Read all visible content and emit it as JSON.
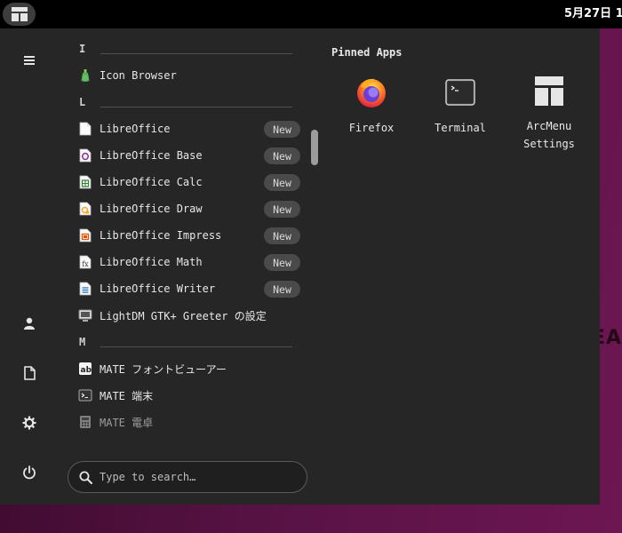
{
  "topbar": {
    "clock": "5月27日 1"
  },
  "watermark": {
    "text": "CDEA"
  },
  "sidebar": {
    "items": [
      {
        "name": "hamburger-menu"
      },
      {
        "name": "user"
      },
      {
        "name": "documents"
      },
      {
        "name": "settings"
      },
      {
        "name": "power"
      }
    ]
  },
  "app_list": {
    "sections": [
      {
        "letter": "I"
      },
      {
        "letter": "L"
      },
      {
        "letter": "M"
      }
    ],
    "apps": [
      {
        "label": "Icon Browser",
        "icon": "icon-browser-icon",
        "badge": ""
      },
      {
        "label": "LibreOffice",
        "icon": "libreoffice-icon",
        "badge": "New"
      },
      {
        "label": "LibreOffice Base",
        "icon": "libreoffice-base-icon",
        "badge": "New"
      },
      {
        "label": "LibreOffice Calc",
        "icon": "libreoffice-calc-icon",
        "badge": "New"
      },
      {
        "label": "LibreOffice Draw",
        "icon": "libreoffice-draw-icon",
        "badge": "New"
      },
      {
        "label": "LibreOffice Impress",
        "icon": "libreoffice-impress-icon",
        "badge": "New"
      },
      {
        "label": "LibreOffice Math",
        "icon": "libreoffice-math-icon",
        "badge": "New"
      },
      {
        "label": "LibreOffice Writer",
        "icon": "libreoffice-writer-icon",
        "badge": "New"
      },
      {
        "label": "LightDM GTK+ Greeter の設定",
        "icon": "lightdm-greeter-icon",
        "badge": ""
      },
      {
        "label": "MATE フォントビューアー",
        "icon": "font-viewer-icon",
        "badge": ""
      },
      {
        "label": "MATE 端末",
        "icon": "terminal-icon",
        "badge": ""
      },
      {
        "label": "MATE 電卓",
        "icon": "calculator-icon",
        "badge": ""
      }
    ]
  },
  "search": {
    "placeholder": "Type to search…"
  },
  "pinned": {
    "title": "Pinned Apps",
    "apps": [
      {
        "label": "Firefox",
        "icon": "firefox-icon"
      },
      {
        "label": "Terminal",
        "icon": "terminal-icon"
      },
      {
        "label_line1": "ArcMenu",
        "label_line2": "Settings",
        "icon": "arcmenu-layout-icon"
      }
    ]
  },
  "colors": {
    "menu_bg": "#262626",
    "badge_bg": "#4a4a4a",
    "topbar_bg": "#000000",
    "desktop_accent": "#6d1652"
  }
}
